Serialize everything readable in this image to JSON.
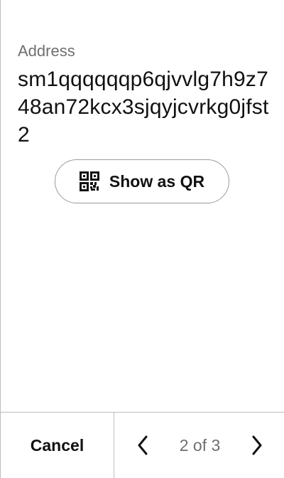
{
  "address": {
    "label": "Address",
    "value": "sm1qqqqqqp6qjvvlg7h9z748an72kcx3sjqyjcvrkg0jfst2"
  },
  "qr_button": {
    "label": "Show as QR",
    "icon": "qr-code-icon"
  },
  "footer": {
    "cancel_label": "Cancel",
    "pager_text": "2 of 3",
    "prev_icon": "chevron-left-icon",
    "next_icon": "chevron-right-icon"
  }
}
